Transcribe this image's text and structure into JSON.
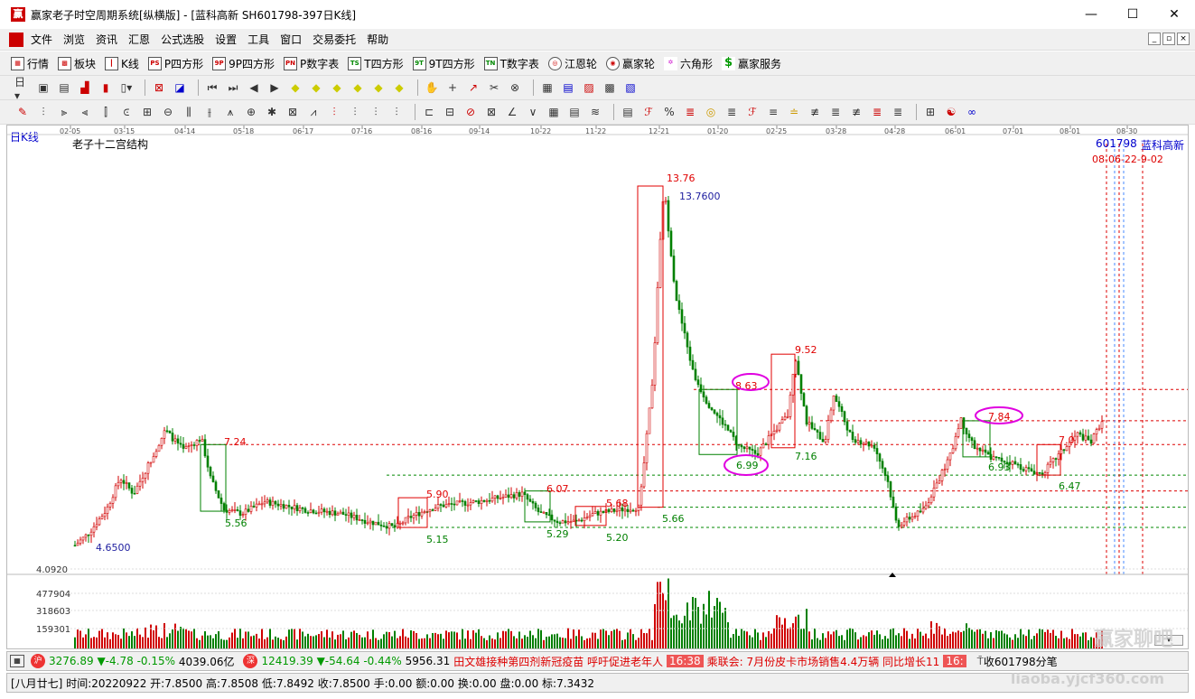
{
  "window": {
    "title": "赢家老子时空周期系统[纵横版] - [蓝科高新  SH601798-397日K线]",
    "app_icon": "赢",
    "minimize": "—",
    "maximize": "☐",
    "close": "✕"
  },
  "menu": [
    "文件",
    "浏览",
    "资讯",
    "汇恩",
    "公式选股",
    "设置",
    "工具",
    "窗口",
    "交易委托",
    "帮助"
  ],
  "toolbar1": [
    {
      "icon": "grid-icon",
      "label": "行情"
    },
    {
      "icon": "blocks-icon",
      "label": "板块"
    },
    {
      "icon": "candle-icon",
      "label": "K线"
    },
    {
      "icon": "ps-icon",
      "label": "P四方形"
    },
    {
      "icon": "9p-icon",
      "label": "9P四方形"
    },
    {
      "icon": "pn-icon",
      "label": "P数字表"
    },
    {
      "icon": "ts-icon",
      "label": "T四方形"
    },
    {
      "icon": "9t-icon",
      "label": "9T四方形"
    },
    {
      "icon": "tn-icon",
      "label": "T数字表"
    },
    {
      "icon": "wheel-icon",
      "label": "江恩轮"
    },
    {
      "icon": "yj-wheel-icon",
      "label": "赢家轮"
    },
    {
      "icon": "hexagon-icon",
      "label": "六角形"
    },
    {
      "icon": "dollar-icon",
      "label": "赢家服务"
    }
  ],
  "chart": {
    "period_label": "日K线",
    "indicator_title": "老子十二宫结构",
    "code": "601798",
    "name": "蓝科高新",
    "date_labels": [
      "02-05",
      "03-15",
      "04-14",
      "05-18",
      "06-17",
      "07-16",
      "08-16",
      "09-14",
      "10-22",
      "11-22",
      "12-21",
      "01-20",
      "02-25",
      "03-28",
      "04-28",
      "06-01",
      "07-01",
      "08-01",
      "08-30"
    ],
    "cycle_dates_overlap": "08-06-22-9-02",
    "price_labels": {
      "hi": "13.76",
      "hi_mark": "13.7600",
      "p952": "9.52",
      "p863": "8.63",
      "p784": "7.84",
      "p724": "7.24",
      "p699": "6.99",
      "p716": "7.16",
      "p693": "6.93",
      "p647": "6.47",
      "p607": "6.07",
      "p590": "5.90",
      "p568": "5.68",
      "p566": "5.66",
      "p556": "5.56",
      "p520": "5.20",
      "p515": "5.15",
      "p529": "5.29",
      "p46": "4.6500",
      "p70": "7.0"
    },
    "y_axis": {
      "low": "4.0920",
      "v1": "477904",
      "v2": "318603",
      "v3": "159301"
    }
  },
  "ticker": {
    "sh_index": "3276.89",
    "sh_chg": "▼-4.78",
    "sh_pct": "-0.15%",
    "sh_amt": "4039.06亿",
    "sz_index": "12419.39",
    "sz_chg": "▼-54.64",
    "sz_pct": "-0.44%",
    "sz_amt": "5956.31",
    "news1": "田文雄接种第四剂新冠疫苗 呼吁促进老年人",
    "time1": "16:38",
    "news2": "乘联会:  7月份皮卡市场销售4.4万辆 同比增长11",
    "time2": "16:",
    "close_note": "收601798分笔"
  },
  "status": {
    "date": "[八月廿七]",
    "time": "时间:20220922",
    "open": "开:7.8500",
    "high": "高:7.8508",
    "low": "低:7.8492",
    "close": "收:7.8500",
    "hand": "手:0.00",
    "amount": "额:0.00",
    "turnover": "换:0.00",
    "pan": "盘:0.00",
    "mark": "标:7.3432"
  },
  "watermark": "赢家聊吧",
  "watermark_url": "liaoba.yjcf360.com",
  "colors": {
    "up": "#d00000",
    "down": "#008000",
    "box_red": "#e00000",
    "box_green": "#008000",
    "magenta": "#e000e0",
    "blue": "#2020a0",
    "grid": "#c0c0c0"
  }
}
